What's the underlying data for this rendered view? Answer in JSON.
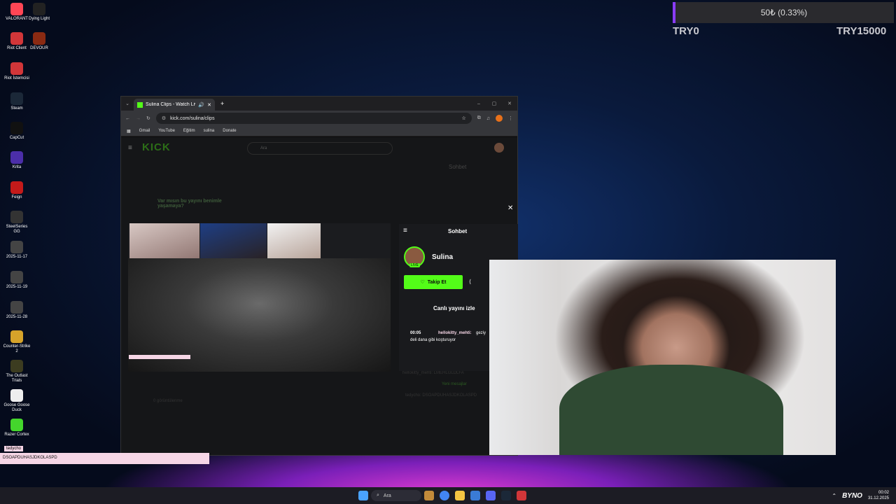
{
  "desktop": {
    "icons": [
      {
        "label": "VALORANT",
        "color": "#ff4655",
        "icon": "valorant-icon"
      },
      {
        "label": "Dying Light",
        "color": "#222222",
        "icon": "dying-light-icon"
      },
      {
        "label": "Riot Client",
        "color": "#d13639",
        "icon": "riot-client-icon"
      },
      {
        "label": "DEVOUR",
        "color": "#8a2a12",
        "icon": "devour-icon"
      },
      {
        "label": "Riot İstemcisi",
        "color": "#d13639",
        "icon": "riot-istemcisi-icon"
      },
      {
        "label": "Steam",
        "color": "#1b2838",
        "icon": "steam-icon"
      },
      {
        "label": "CapCut",
        "color": "#111111",
        "icon": "capcut-icon"
      },
      {
        "label": "Krita",
        "color": "#4b2ea8",
        "icon": "krita-icon"
      },
      {
        "label": "Feign",
        "color": "#c41a1a",
        "icon": "feign-icon"
      },
      {
        "label": "SteelSeries GG",
        "color": "#333333",
        "icon": "steelseries-icon"
      },
      {
        "label": "2025-11-17",
        "color": "#444444",
        "icon": "screenshot-file-icon"
      },
      {
        "label": "2025-11-19",
        "color": "#444444",
        "icon": "screenshot-file-icon"
      },
      {
        "label": "2025-11-28",
        "color": "#444444",
        "icon": "screenshot-file-icon"
      },
      {
        "label": "Counter-Strike 2",
        "color": "#d6a32a",
        "icon": "cs2-icon"
      },
      {
        "label": "The Outlast Trials",
        "color": "#3c3c20",
        "icon": "outlast-icon"
      },
      {
        "label": "Goose Goose Duck",
        "color": "#eeeeee",
        "icon": "goose-icon"
      },
      {
        "label": "Razer Cortex",
        "color": "#44d62c",
        "icon": "razer-icon"
      }
    ],
    "chat_overlay_user": "tedycho",
    "chat_overlay_text": "DSOAPDUHASJDKOLASPD"
  },
  "goal": {
    "text": "50₺ (0.33%)",
    "progress": 0.0033,
    "min_label": "TRY0",
    "max_label": "TRY15000",
    "accent": "#8a3cff"
  },
  "browser": {
    "tab_title": "Sulina Clips - Watch Live on",
    "url": "kick.com/sulina/clips",
    "bookmarks": [
      "Gmail",
      "YouTube",
      "Eğitim",
      "sulina",
      "Donate"
    ],
    "brand_color": "#53fc18"
  },
  "kick": {
    "logo": "KICK",
    "search_placeholder": "Ara",
    "sohbet": "Sohbet",
    "streamer": "Sulina",
    "live_badge": "LIVE",
    "follow_label": "Takip Et",
    "watch_live": "Canlı yayını izle",
    "bg_prompt": "Var mısın bu yayını benimle yaşamaya?",
    "chat_time": "00:05",
    "chat_user": "hellokitty_mehti:",
    "chat_text_1": "geziy",
    "chat_text_2": "deli dana gibi koşturuyor",
    "bg_chat_1": "hellokitty_mehti: LMEHLGLDLFA",
    "bg_chat_2": "Yeni mesajlar",
    "bg_chat_3": "tedycho: DSOAPDUHASJDKOLASPD",
    "views": "0 görüntülenme"
  },
  "taskbar": {
    "search": "Ara",
    "time": "00:02",
    "date": "31.12.2025",
    "watermark": "BYNO"
  }
}
